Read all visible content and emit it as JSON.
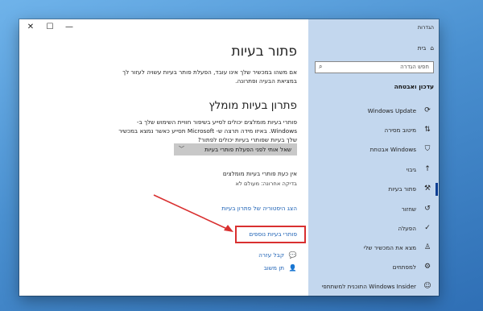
{
  "window": {
    "close_glyph": "✕",
    "maximize_glyph": "☐",
    "minimize_glyph": "—"
  },
  "main": {
    "title": "פתור בעיות",
    "intro": "אם משהו במכשיר שלך אינו עובד, הפעלת פותר בעיות עשויה לעזור לך במציאת הבעיה ופתרונה.",
    "recommended_title": "פתרון בעיות מומלץ",
    "recommended_desc": "פותרי בעיות מומלצים יכולים לסייע בשיפור חוויית השימוש שלך ב- Windows. באיזו מידה תרצה ש- Microsoft תסייע כאשר נמצא במכשיר שלך בעיות שפותרי בעיות יכולים לפתור?",
    "dropdown_value": "שאל אותי לפני הפעלת פותרי בעיות",
    "no_recommended": "אין כעת פותרי בעיות מומלצים",
    "last_checked": "בדיקה אחרונה: מעולם לא",
    "history_link": "הצג היסטוריה של פתרון בעיות",
    "additional_link": "פותרי בעיות נוספים",
    "get_help": "קבל עזרה",
    "give_feedback": "תן משוב"
  },
  "sidebar": {
    "window_title": "הגדרות",
    "home": "בית",
    "search_placeholder": "חפש הגדרה",
    "section": "עדכון ואבטחה",
    "items": [
      {
        "label": "Windows Update",
        "icon": "refresh-icon",
        "glyph": "⟳"
      },
      {
        "label": "מיטוב מסירה",
        "icon": "delivery-icon",
        "glyph": "⇅"
      },
      {
        "label": "אבטחת Windows",
        "icon": "shield-icon",
        "glyph": "⛉"
      },
      {
        "label": "גיבוי",
        "icon": "backup-icon",
        "glyph": "↑"
      },
      {
        "label": "פתור בעיות",
        "icon": "wrench-icon",
        "glyph": "⚒"
      },
      {
        "label": "שחזור",
        "icon": "recovery-icon",
        "glyph": "↺"
      },
      {
        "label": "הפעלה",
        "icon": "activation-icon",
        "glyph": "✓"
      },
      {
        "label": "מצא את המכשיר שלי",
        "icon": "person-pin-icon",
        "glyph": "♙"
      },
      {
        "label": "למפתחים",
        "icon": "developer-icon",
        "glyph": "⚙"
      },
      {
        "label": "התוכנית למשתתפי Windows Insider",
        "icon": "insider-icon",
        "glyph": "☺"
      }
    ]
  },
  "colors": {
    "accent_link": "#1a5fb4",
    "highlight_box": "#d93030",
    "sidebar_bg": "#c3d7ee"
  }
}
